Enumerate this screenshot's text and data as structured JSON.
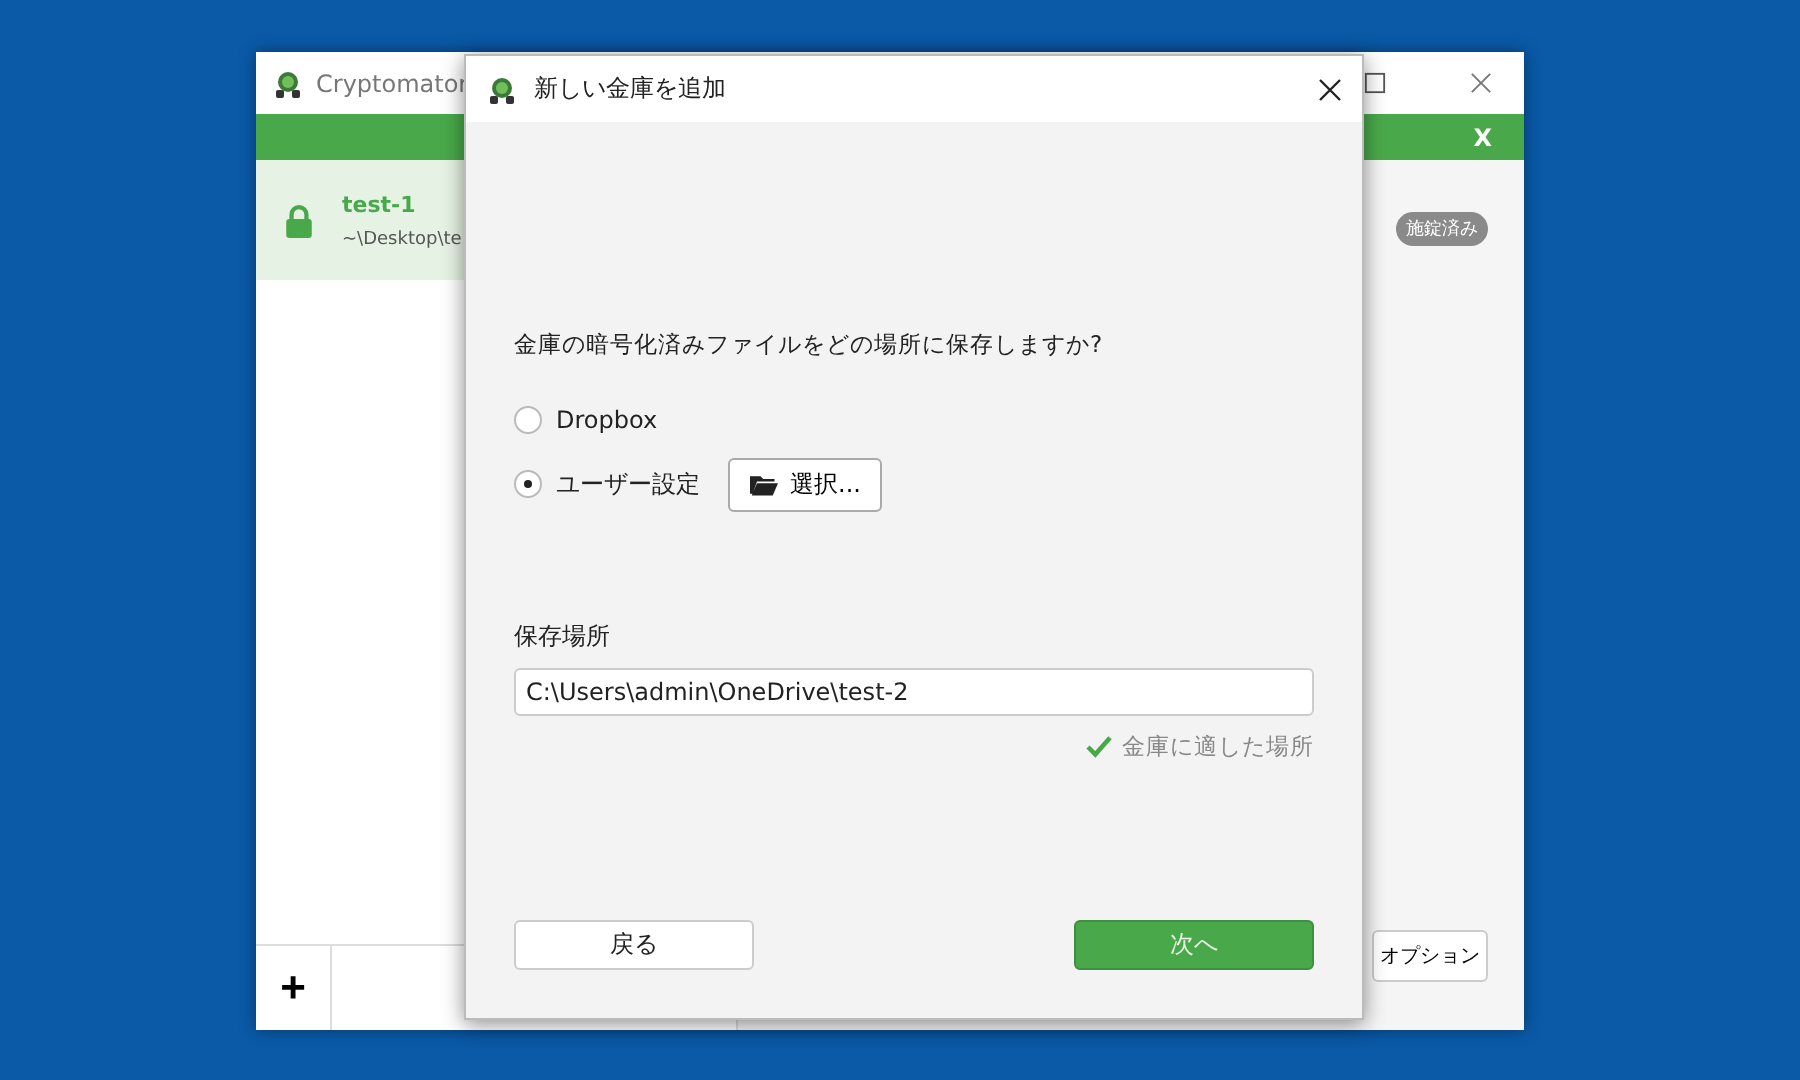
{
  "main_window": {
    "title": "Cryptomator",
    "banner_close": "X",
    "vaults": [
      {
        "name": "test-1",
        "path": "~\\Desktop\\te",
        "locked": true,
        "selected": true
      }
    ],
    "status_badge": "施錠済み",
    "add_button": "+",
    "options_button": "オプション"
  },
  "dialog": {
    "title": "新しい金庫を追加",
    "question": "金庫の暗号化済みファイルをどの場所に保存しますか?",
    "options": [
      {
        "kind": "cloud",
        "label": "Dropbox",
        "selected": false
      },
      {
        "kind": "custom",
        "label": "ユーザー設定",
        "selected": true
      }
    ],
    "choose_button": "選択...",
    "location_label": "保存場所",
    "location_value": "C:\\Users\\admin\\OneDrive\\test-2",
    "validation": "金庫に適した場所",
    "back_button": "戻る",
    "next_button": "次へ"
  }
}
